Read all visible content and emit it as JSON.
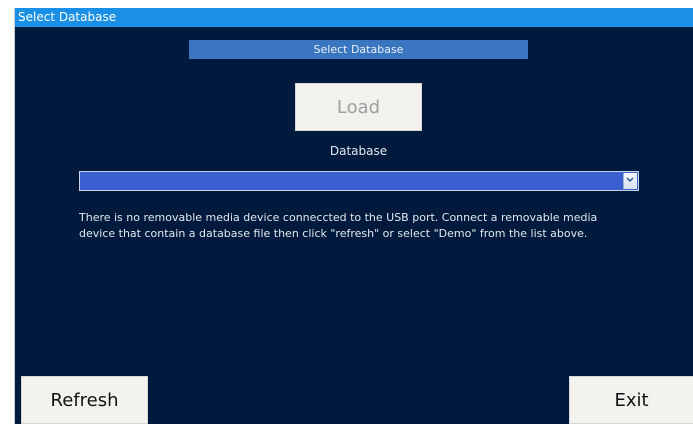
{
  "window": {
    "title": "Select Database"
  },
  "header": {
    "title": "Select Database"
  },
  "actions": {
    "load_label": "Load",
    "refresh_label": "Refresh",
    "exit_label": "Exit"
  },
  "database": {
    "label": "Database",
    "selected_value": "",
    "icon": "chevron-down-icon"
  },
  "message": {
    "lines": [
      "There is no removable media device conneccted to the USB port. Connect a removable media",
      "device that contain a database file then click \"refresh\" or select \"Demo\" from the list above."
    ]
  },
  "colors": {
    "window_background": "#001a3d",
    "title_bar": "#1a8fe6",
    "section_header": "#3a76c0",
    "select_background": "#3a5fd0",
    "button_background": "#f3f2ee"
  }
}
